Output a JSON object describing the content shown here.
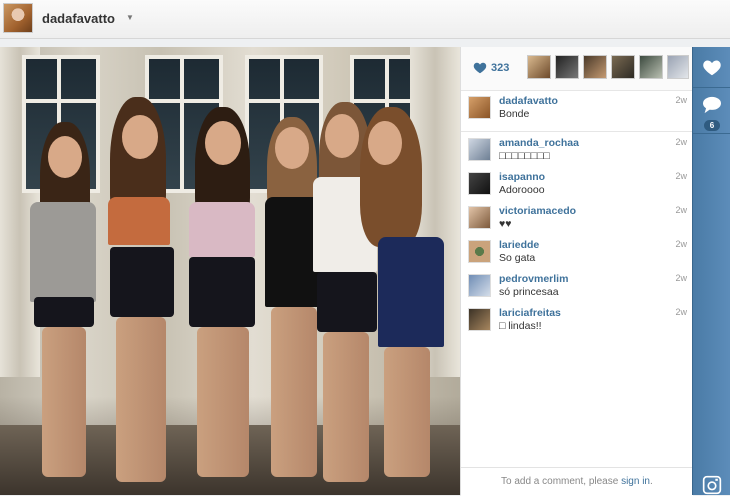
{
  "header": {
    "username": "dadafavatto",
    "caret": "▼"
  },
  "photo": {
    "description_icon": "group-photo"
  },
  "likes": {
    "count": "323",
    "icon": "heart-icon",
    "liker_count": 6
  },
  "comments": [
    {
      "user": "dadafavatto",
      "text": "Bonde",
      "time": "2w"
    },
    {
      "user": "amanda_rochaa",
      "text": "□□□□□□□□",
      "time": "2w"
    },
    {
      "user": "isapanno",
      "text": "Adoroooo",
      "time": "2w"
    },
    {
      "user": "victoriamacedo",
      "text": "♥♥",
      "time": "2w"
    },
    {
      "user": "lariedde",
      "text": "So gata",
      "time": "2w"
    },
    {
      "user": "pedrovmerlim",
      "text": "só princesaa",
      "time": "2w"
    },
    {
      "user": "lariciafreitas",
      "text": "□ lindas!!",
      "time": "2w"
    }
  ],
  "comment_input": {
    "prefix": "To add a comment, please ",
    "link": "sign in",
    "suffix": "."
  },
  "rail": {
    "comment_count": "6",
    "like_icon": "heart-icon",
    "comment_icon": "speech-bubble-icon",
    "camera_icon": "instagram-camera-icon"
  },
  "colors": {
    "accent": "#3f729b",
    "rail": "#4f80ad"
  }
}
